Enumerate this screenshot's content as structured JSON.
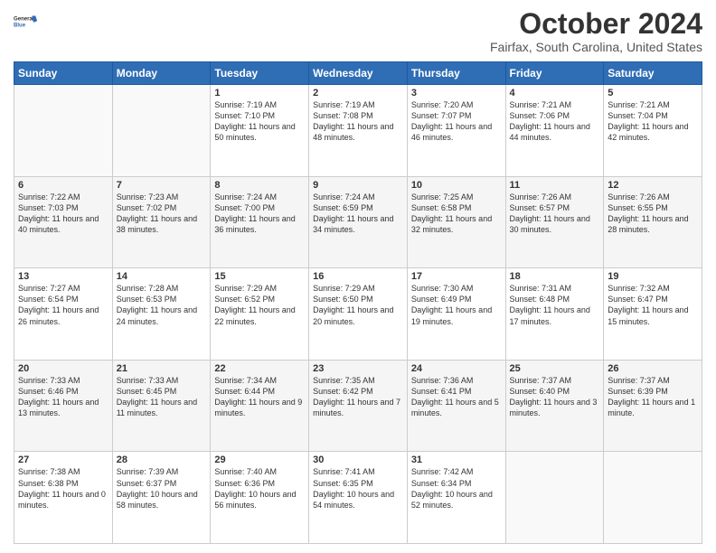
{
  "header": {
    "logo_line1": "General",
    "logo_line2": "Blue",
    "month_title": "October 2024",
    "location": "Fairfax, South Carolina, United States"
  },
  "days_of_week": [
    "Sunday",
    "Monday",
    "Tuesday",
    "Wednesday",
    "Thursday",
    "Friday",
    "Saturday"
  ],
  "weeks": [
    [
      {
        "day": "",
        "sunrise": "",
        "sunset": "",
        "daylight": ""
      },
      {
        "day": "",
        "sunrise": "",
        "sunset": "",
        "daylight": ""
      },
      {
        "day": "1",
        "sunrise": "Sunrise: 7:19 AM",
        "sunset": "Sunset: 7:10 PM",
        "daylight": "Daylight: 11 hours and 50 minutes."
      },
      {
        "day": "2",
        "sunrise": "Sunrise: 7:19 AM",
        "sunset": "Sunset: 7:08 PM",
        "daylight": "Daylight: 11 hours and 48 minutes."
      },
      {
        "day": "3",
        "sunrise": "Sunrise: 7:20 AM",
        "sunset": "Sunset: 7:07 PM",
        "daylight": "Daylight: 11 hours and 46 minutes."
      },
      {
        "day": "4",
        "sunrise": "Sunrise: 7:21 AM",
        "sunset": "Sunset: 7:06 PM",
        "daylight": "Daylight: 11 hours and 44 minutes."
      },
      {
        "day": "5",
        "sunrise": "Sunrise: 7:21 AM",
        "sunset": "Sunset: 7:04 PM",
        "daylight": "Daylight: 11 hours and 42 minutes."
      }
    ],
    [
      {
        "day": "6",
        "sunrise": "Sunrise: 7:22 AM",
        "sunset": "Sunset: 7:03 PM",
        "daylight": "Daylight: 11 hours and 40 minutes."
      },
      {
        "day": "7",
        "sunrise": "Sunrise: 7:23 AM",
        "sunset": "Sunset: 7:02 PM",
        "daylight": "Daylight: 11 hours and 38 minutes."
      },
      {
        "day": "8",
        "sunrise": "Sunrise: 7:24 AM",
        "sunset": "Sunset: 7:00 PM",
        "daylight": "Daylight: 11 hours and 36 minutes."
      },
      {
        "day": "9",
        "sunrise": "Sunrise: 7:24 AM",
        "sunset": "Sunset: 6:59 PM",
        "daylight": "Daylight: 11 hours and 34 minutes."
      },
      {
        "day": "10",
        "sunrise": "Sunrise: 7:25 AM",
        "sunset": "Sunset: 6:58 PM",
        "daylight": "Daylight: 11 hours and 32 minutes."
      },
      {
        "day": "11",
        "sunrise": "Sunrise: 7:26 AM",
        "sunset": "Sunset: 6:57 PM",
        "daylight": "Daylight: 11 hours and 30 minutes."
      },
      {
        "day": "12",
        "sunrise": "Sunrise: 7:26 AM",
        "sunset": "Sunset: 6:55 PM",
        "daylight": "Daylight: 11 hours and 28 minutes."
      }
    ],
    [
      {
        "day": "13",
        "sunrise": "Sunrise: 7:27 AM",
        "sunset": "Sunset: 6:54 PM",
        "daylight": "Daylight: 11 hours and 26 minutes."
      },
      {
        "day": "14",
        "sunrise": "Sunrise: 7:28 AM",
        "sunset": "Sunset: 6:53 PM",
        "daylight": "Daylight: 11 hours and 24 minutes."
      },
      {
        "day": "15",
        "sunrise": "Sunrise: 7:29 AM",
        "sunset": "Sunset: 6:52 PM",
        "daylight": "Daylight: 11 hours and 22 minutes."
      },
      {
        "day": "16",
        "sunrise": "Sunrise: 7:29 AM",
        "sunset": "Sunset: 6:50 PM",
        "daylight": "Daylight: 11 hours and 20 minutes."
      },
      {
        "day": "17",
        "sunrise": "Sunrise: 7:30 AM",
        "sunset": "Sunset: 6:49 PM",
        "daylight": "Daylight: 11 hours and 19 minutes."
      },
      {
        "day": "18",
        "sunrise": "Sunrise: 7:31 AM",
        "sunset": "Sunset: 6:48 PM",
        "daylight": "Daylight: 11 hours and 17 minutes."
      },
      {
        "day": "19",
        "sunrise": "Sunrise: 7:32 AM",
        "sunset": "Sunset: 6:47 PM",
        "daylight": "Daylight: 11 hours and 15 minutes."
      }
    ],
    [
      {
        "day": "20",
        "sunrise": "Sunrise: 7:33 AM",
        "sunset": "Sunset: 6:46 PM",
        "daylight": "Daylight: 11 hours and 13 minutes."
      },
      {
        "day": "21",
        "sunrise": "Sunrise: 7:33 AM",
        "sunset": "Sunset: 6:45 PM",
        "daylight": "Daylight: 11 hours and 11 minutes."
      },
      {
        "day": "22",
        "sunrise": "Sunrise: 7:34 AM",
        "sunset": "Sunset: 6:44 PM",
        "daylight": "Daylight: 11 hours and 9 minutes."
      },
      {
        "day": "23",
        "sunrise": "Sunrise: 7:35 AM",
        "sunset": "Sunset: 6:42 PM",
        "daylight": "Daylight: 11 hours and 7 minutes."
      },
      {
        "day": "24",
        "sunrise": "Sunrise: 7:36 AM",
        "sunset": "Sunset: 6:41 PM",
        "daylight": "Daylight: 11 hours and 5 minutes."
      },
      {
        "day": "25",
        "sunrise": "Sunrise: 7:37 AM",
        "sunset": "Sunset: 6:40 PM",
        "daylight": "Daylight: 11 hours and 3 minutes."
      },
      {
        "day": "26",
        "sunrise": "Sunrise: 7:37 AM",
        "sunset": "Sunset: 6:39 PM",
        "daylight": "Daylight: 11 hours and 1 minute."
      }
    ],
    [
      {
        "day": "27",
        "sunrise": "Sunrise: 7:38 AM",
        "sunset": "Sunset: 6:38 PM",
        "daylight": "Daylight: 11 hours and 0 minutes."
      },
      {
        "day": "28",
        "sunrise": "Sunrise: 7:39 AM",
        "sunset": "Sunset: 6:37 PM",
        "daylight": "Daylight: 10 hours and 58 minutes."
      },
      {
        "day": "29",
        "sunrise": "Sunrise: 7:40 AM",
        "sunset": "Sunset: 6:36 PM",
        "daylight": "Daylight: 10 hours and 56 minutes."
      },
      {
        "day": "30",
        "sunrise": "Sunrise: 7:41 AM",
        "sunset": "Sunset: 6:35 PM",
        "daylight": "Daylight: 10 hours and 54 minutes."
      },
      {
        "day": "31",
        "sunrise": "Sunrise: 7:42 AM",
        "sunset": "Sunset: 6:34 PM",
        "daylight": "Daylight: 10 hours and 52 minutes."
      },
      {
        "day": "",
        "sunrise": "",
        "sunset": "",
        "daylight": ""
      },
      {
        "day": "",
        "sunrise": "",
        "sunset": "",
        "daylight": ""
      }
    ]
  ]
}
